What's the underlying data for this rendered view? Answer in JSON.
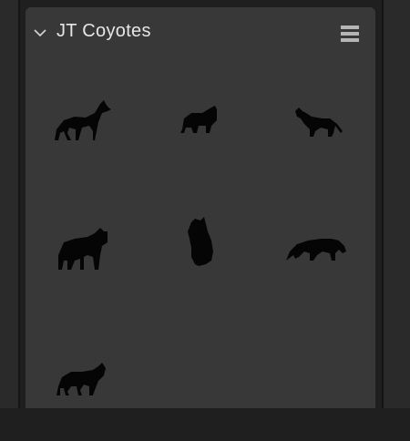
{
  "panel": {
    "title": "JT Coyotes"
  },
  "icons": {
    "collapse": "chevron-down-icon",
    "menu": "menu-icon"
  },
  "items": [
    {
      "name": "coyote-1"
    },
    {
      "name": "coyote-2"
    },
    {
      "name": "coyote-3"
    },
    {
      "name": "coyote-4"
    },
    {
      "name": "coyote-5"
    },
    {
      "name": "coyote-6"
    },
    {
      "name": "coyote-7"
    }
  ]
}
